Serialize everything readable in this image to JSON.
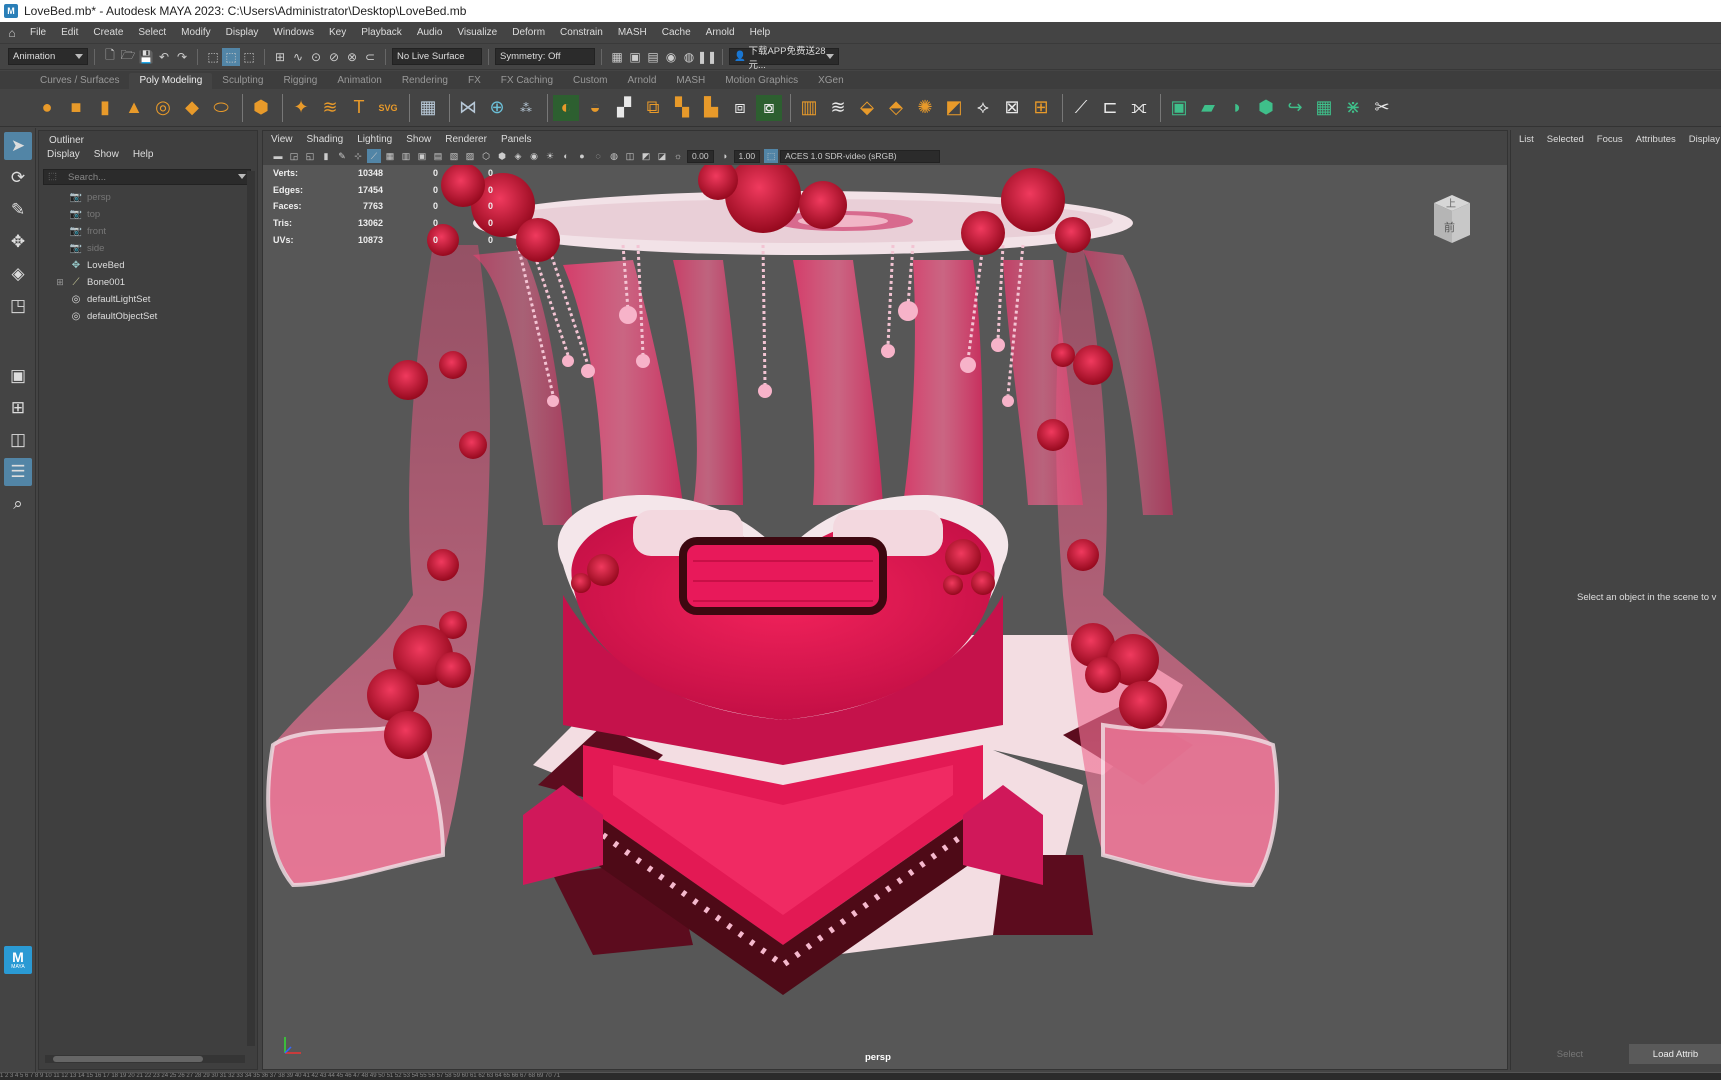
{
  "window": {
    "title": "LoveBed.mb* - Autodesk MAYA 2023: C:\\Users\\Administrator\\Desktop\\LoveBed.mb",
    "app_icon": "M"
  },
  "menubar": {
    "items": [
      "File",
      "Edit",
      "Create",
      "Select",
      "Modify",
      "Display",
      "Windows",
      "Key",
      "Playback",
      "Audio",
      "Visualize",
      "Deform",
      "Constrain",
      "MASH",
      "Cache",
      "Arnold",
      "Help"
    ]
  },
  "statusline": {
    "menuset": "Animation",
    "live_surface": "No Live Surface",
    "symmetry": "Symmetry: Off",
    "account": "下载APP免费送28元..."
  },
  "shelf": {
    "tabs": [
      "Curves / Surfaces",
      "Poly Modeling",
      "Sculpting",
      "Rigging",
      "Animation",
      "Rendering",
      "FX",
      "FX Caching",
      "Custom",
      "Arnold",
      "MASH",
      "Motion Graphics",
      "XGen"
    ],
    "active_tab": "Poly Modeling"
  },
  "outliner": {
    "title": "Outliner",
    "menu": [
      "Display",
      "Show",
      "Help"
    ],
    "search_placeholder": "Search...",
    "items": [
      {
        "label": "persp",
        "icon": "camera-icon",
        "dim": true
      },
      {
        "label": "top",
        "icon": "camera-icon",
        "dim": true
      },
      {
        "label": "front",
        "icon": "camera-icon",
        "dim": true
      },
      {
        "label": "side",
        "icon": "camera-icon",
        "dim": true
      },
      {
        "label": "LoveBed",
        "icon": "mesh-icon",
        "dim": false
      },
      {
        "label": "Bone001",
        "icon": "joint-icon",
        "dim": false
      },
      {
        "label": "defaultLightSet",
        "icon": "set-icon",
        "dim": false
      },
      {
        "label": "defaultObjectSet",
        "icon": "set-icon",
        "dim": false
      }
    ]
  },
  "viewport": {
    "menu": [
      "View",
      "Shading",
      "Lighting",
      "Show",
      "Renderer",
      "Panels"
    ],
    "field_value_1": "0.00",
    "field_value_2": "1.00",
    "color_space": "ACES 1.0 SDR-video (sRGB)",
    "camera": "persp",
    "viewcube_top": "上",
    "viewcube_front": "前",
    "hud": [
      {
        "label": "Verts:",
        "v1": "10348",
        "v2": "0",
        "v3": "0"
      },
      {
        "label": "Edges:",
        "v1": "17454",
        "v2": "0",
        "v3": "0"
      },
      {
        "label": "Faces:",
        "v1": "7763",
        "v2": "0",
        "v3": "0"
      },
      {
        "label": "Tris:",
        "v1": "13062",
        "v2": "0",
        "v3": "0"
      },
      {
        "label": "UVs:",
        "v1": "10873",
        "v2": "0",
        "v3": "0"
      }
    ]
  },
  "attribute_editor": {
    "tabs": [
      "List",
      "Selected",
      "Focus",
      "Attributes",
      "Display"
    ],
    "message": "Select an object in the scene to v",
    "select_button": "Select",
    "load_button": "Load Attrib"
  },
  "toolbox": {
    "logo": "M",
    "logo_sub": "MAYA"
  },
  "timeline": {
    "ticks": "1 2 3 4 5 6 7 8 9 10 11 12 13 14 15 16 17 18 19 20 21 22 23 24 25 26 27 28 29 30 31 32 33 34 35 36 37 38 39 40 41 42 43 44 45 46 47 48 49 50 51 52 53 54 55 56 57 58 59 60 61 62 63 64 65 66 67 68 69 70 71"
  },
  "colors": {
    "accent": "#5285a6",
    "bed_pink": "#e8175d",
    "rose_red": "#c2123c"
  }
}
